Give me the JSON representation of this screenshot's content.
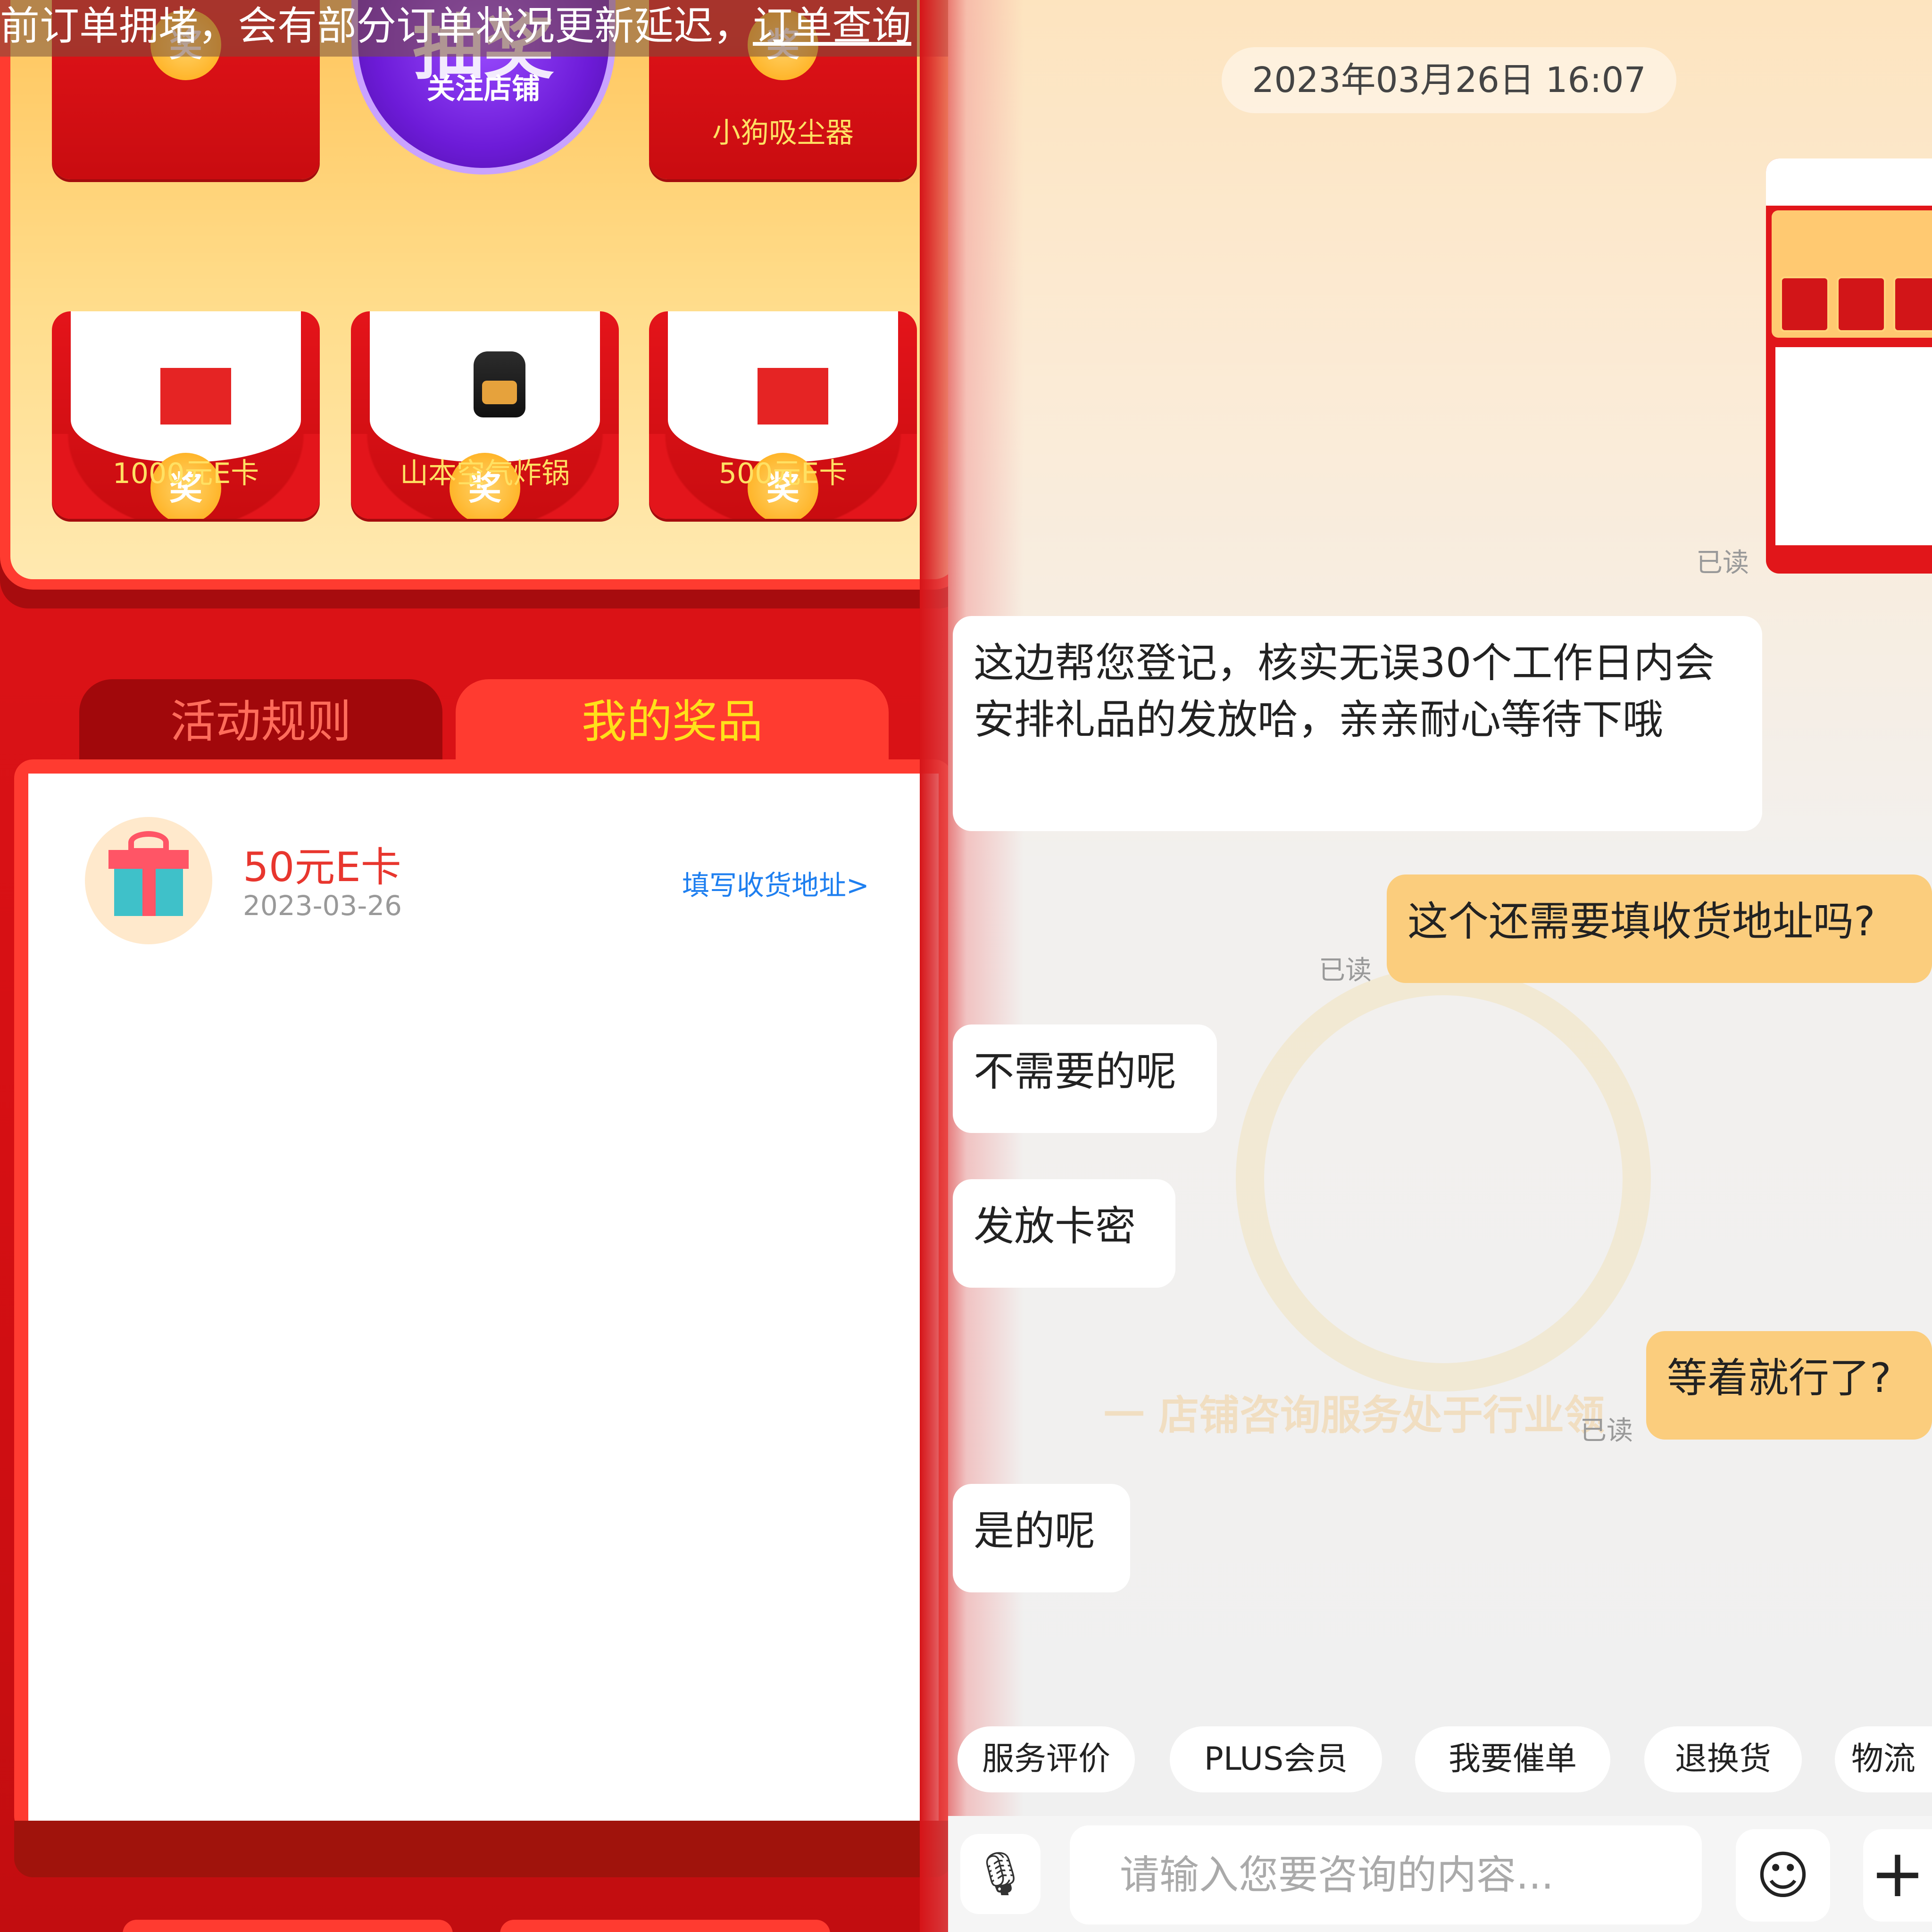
{
  "notice": {
    "text": "前订单拥堵，会有部分订单状况更新延迟，",
    "link": "订单查询",
    "close_icon": "×"
  },
  "lottery": {
    "center_button": {
      "title": "抽奖",
      "subtitle": "关注店铺"
    },
    "coin_label": "奖",
    "top_right_prize": "小狗吸尘器",
    "prizes": [
      {
        "label": "1000元E卡"
      },
      {
        "label": "山本空气炸锅"
      },
      {
        "label": "500元E卡"
      }
    ]
  },
  "tabs": {
    "rules": "活动规则",
    "my_prizes": "我的奖品"
  },
  "my_prize": {
    "name": "50元E卡",
    "date": "2023-03-26",
    "address_link": "填写收货地址>"
  },
  "chat": {
    "timestamp": "2023年03月26日 16:07",
    "read_label": "已读",
    "messages": [
      {
        "from": "agent",
        "text": "这边帮您登记，核实无误30个工作日内会安排礼品的发放哈，亲亲耐心等待下哦"
      },
      {
        "from": "user",
        "text": "这个还需要填收货地址吗?"
      },
      {
        "from": "agent",
        "text": "不需要的呢"
      },
      {
        "from": "agent",
        "text": "发放卡密"
      },
      {
        "from": "user",
        "text": "等着就行了?"
      },
      {
        "from": "agent",
        "text": "是的呢"
      }
    ],
    "watermark_text": "一 店铺咨询服务处于行业领",
    "quick_replies": [
      "服务评价",
      "PLUS会员",
      "我要催单",
      "退换货",
      "物流"
    ],
    "input_placeholder": "请输入您要咨询的内容...",
    "icons": {
      "mic": "microphone-icon",
      "emoji": "emoji-icon",
      "plus": "plus-icon"
    }
  },
  "colors": {
    "lottery_red": "#e0161a",
    "prize_gold": "#ffe163",
    "user_bubble": "#fbcd7d",
    "link_blue": "#1e7ff0",
    "prize_red": "#e8362e"
  }
}
